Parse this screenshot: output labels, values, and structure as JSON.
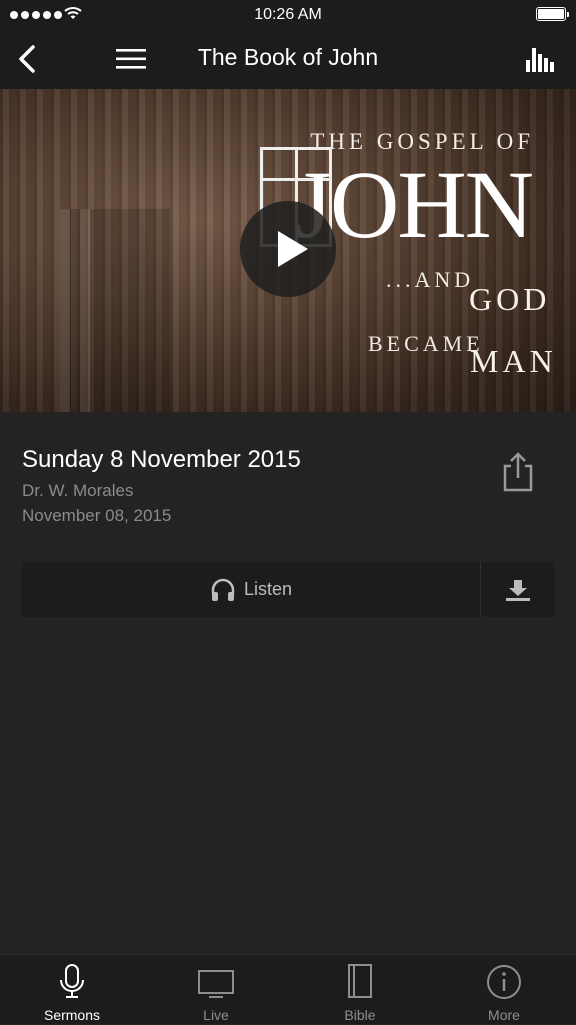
{
  "status_bar": {
    "time": "10:26 AM"
  },
  "nav": {
    "title": "The Book of John"
  },
  "hero": {
    "line1": "THE GOSPEL OF",
    "line2": "JOHN",
    "line3": "...AND",
    "line4": "GOD",
    "line5": "BECAME",
    "line6": "MAN"
  },
  "sermon": {
    "title": "Sunday 8 November 2015",
    "speaker": "Dr. W. Morales",
    "date": "November 08, 2015"
  },
  "actions": {
    "listen_label": "Listen"
  },
  "tabs": [
    {
      "label": "Sermons",
      "icon": "microphone-icon",
      "active": true
    },
    {
      "label": "Live",
      "icon": "tv-icon",
      "active": false
    },
    {
      "label": "Bible",
      "icon": "book-icon",
      "active": false
    },
    {
      "label": "More",
      "icon": "info-icon",
      "active": false
    }
  ],
  "colors": {
    "background": "#232323",
    "bar": "#1c1c1c",
    "muted_text": "#8b8b8b"
  }
}
